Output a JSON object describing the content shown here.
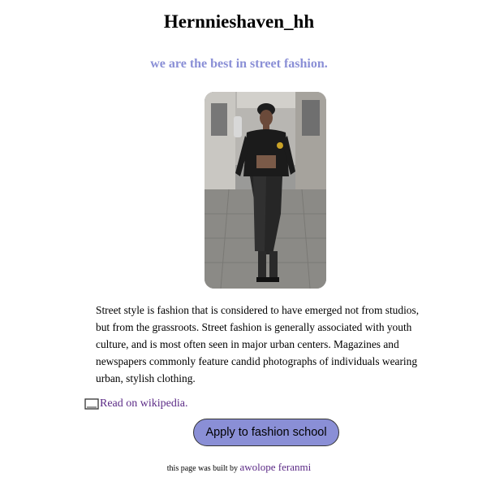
{
  "header": {
    "title": "Hernnieshaven_hh",
    "tagline": "we are the best in street fashion."
  },
  "colors": {
    "accent": "#8a8fd6",
    "link": "#5b2a86"
  },
  "main": {
    "description": "Street style is fashion that is considered to have emerged not from studios, but from the grassroots. Street fashion is generally associated with youth culture, and is most often seen in major urban centers. Magazines and newspapers commonly feature candid photographs of individuals wearing urban, stylish clothing.",
    "wiki_icon": "book-icon",
    "wiki_link_text": "Read on wikipedia.",
    "apply_button_label": "Apply to fashion school"
  },
  "footer": {
    "built_by_text": "this page was built by",
    "author_name": "awolope feranmi"
  }
}
